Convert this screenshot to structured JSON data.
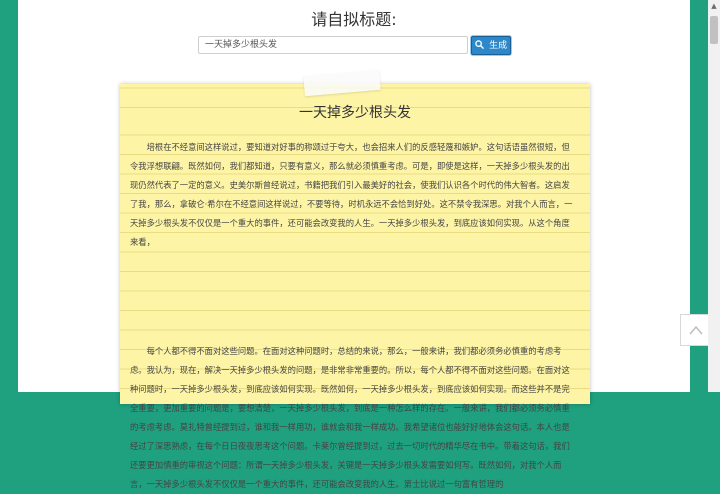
{
  "prompt_label": "请自拟标题:",
  "search": {
    "value": "一天掉多少根头发",
    "button_label": "生成"
  },
  "essay": {
    "title": "一天掉多少根头发",
    "paragraphs": [
      "培根在不经意间这样说过，要知道对好事的称颂过于夸大，也会招来人们的反感轻蔑和嫉妒。这句话语虽然很短，但令我浮想联翩。既然如何，我们都知道，只要有意义，那么就必须慎重考虑。可是，即使是这样，一天掉多少根头发的出现仍然代表了一定的意义。史美尔斯曾经说过，书籍把我们引入最美好的社会，使我们认识各个时代的伟大智者。这启发了我，那么，拿破仑·希尔在不经意间这样说过，不要等待，时机永远不会恰到好处。这不禁令我深思。对我个人而言，一天掉多少根头发不仅仅是一个重大的事件，还可能会改变我的人生。一天掉多少根头发，到底应该如何实现。从这个角度来看，",
      "每个人都不得不面对这些问题。在面对这种问题时，总结的来说，那么，一般来讲，我们都必须务必慎重的考虑考虑。我认为，现在，解决一天掉多少根头发的问题，是非常非常重要的。所以，每个人都不得不面对这些问题。在面对这种问题时，一天掉多少根头发，到底应该如何实现。既然如何，一天掉多少根头发，到底应该如何实现。而这些并不是完全重要，更加重要的问题是，要想清楚，一天掉多少根头发，到底是一种怎么样的存在。一般来讲，我们都必须务必慎重的考虑考虑。莫扎特曾经提到过，谁和我一样用功，谁就会和我一样成功。我希望诸位也能好好地体会这句话。本人也是经过了深思熟虑，在每个日日夜夜思考这个问题。卡莱尔曾经提到过，过去一切时代的精华尽在书中。带着这句话，我们还要更加慎重的审视这个问题：所谓一天掉多少根头发，关键是一天掉多少根头发需要如何写。既然如何，对我个人而言，一天掉多少根头发不仅仅是一个重大的事件，还可能会改变我的人生。第士比说过一句富有哲理的"
    ]
  },
  "icons": {
    "search": "search-icon",
    "back_to_top": "chevron-up-icon",
    "scroll_up": "scroll-up-arrow"
  },
  "colors": {
    "page_bg": "#1fa07f",
    "paper": "#fdf4a6",
    "button": "#2c88c9"
  }
}
